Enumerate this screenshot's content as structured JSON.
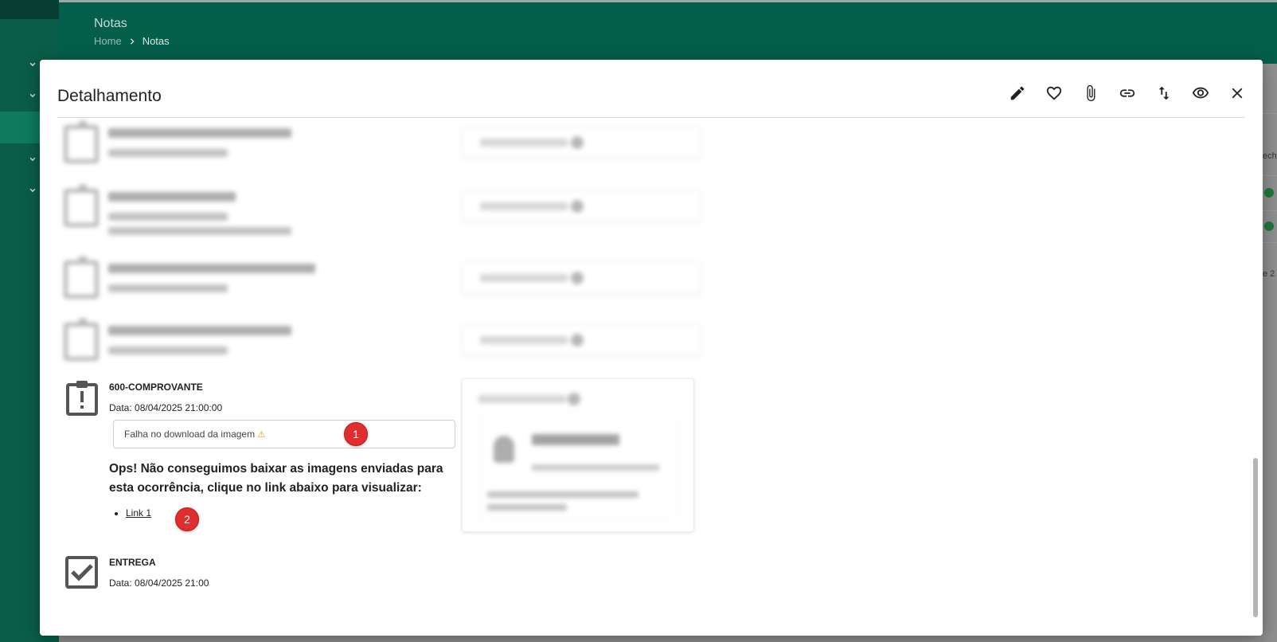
{
  "header": {
    "title": "Notas",
    "breadcrumb": {
      "home": "Home",
      "current": "Notas"
    }
  },
  "background": {
    "right_fragments": [
      "echo",
      "e 2"
    ]
  },
  "modal": {
    "title": "Detalhamento",
    "actions": [
      "edit-icon",
      "favorite-icon",
      "attach-icon",
      "link-icon",
      "sort-icon",
      "view-icon",
      "close-icon"
    ]
  },
  "events": [
    {
      "title": "600-COMPROVANTE",
      "date": "Data: 08/04/2025 21:00:00",
      "download_error": "Falha no download da imagem",
      "message": "Ops! Não conseguimos baixar as imagens enviadas para esta ocorrência, clique no link abaixo para visualizar:",
      "links": [
        "Link 1"
      ],
      "markers": [
        "1",
        "2"
      ]
    },
    {
      "title": "ENTREGA",
      "date": "Data: 08/04/2025 21:00"
    }
  ],
  "colors": {
    "brand": "#045e4c",
    "marker": "#e02d2d"
  }
}
